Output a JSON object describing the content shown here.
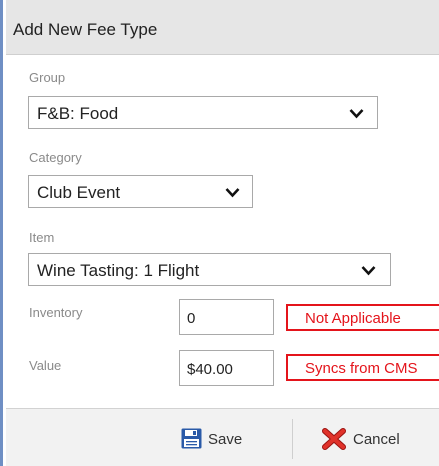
{
  "dialog": {
    "title": "Add New Fee Type"
  },
  "form": {
    "group": {
      "label": "Group",
      "value": "F&B: Food"
    },
    "category": {
      "label": "Category",
      "value": "Club Event"
    },
    "item": {
      "label": "Item",
      "value": "Wine Tasting: 1 Flight"
    },
    "inventory": {
      "label": "Inventory",
      "value": "0",
      "note": "Not Applicable"
    },
    "value": {
      "label": "Value",
      "value": "$40.00",
      "note": "Syncs from CMS"
    }
  },
  "footer": {
    "save_label": "Save",
    "cancel_label": "Cancel"
  },
  "colors": {
    "note_border": "#e4141b",
    "title_bg": "#e6e6e6",
    "save_icon": "#2a5aa8",
    "cancel_icon": "#d8201c"
  },
  "icons": {
    "save": "floppy-disk-icon",
    "cancel": "red-x-icon",
    "dropdown": "chevron-down-icon"
  }
}
